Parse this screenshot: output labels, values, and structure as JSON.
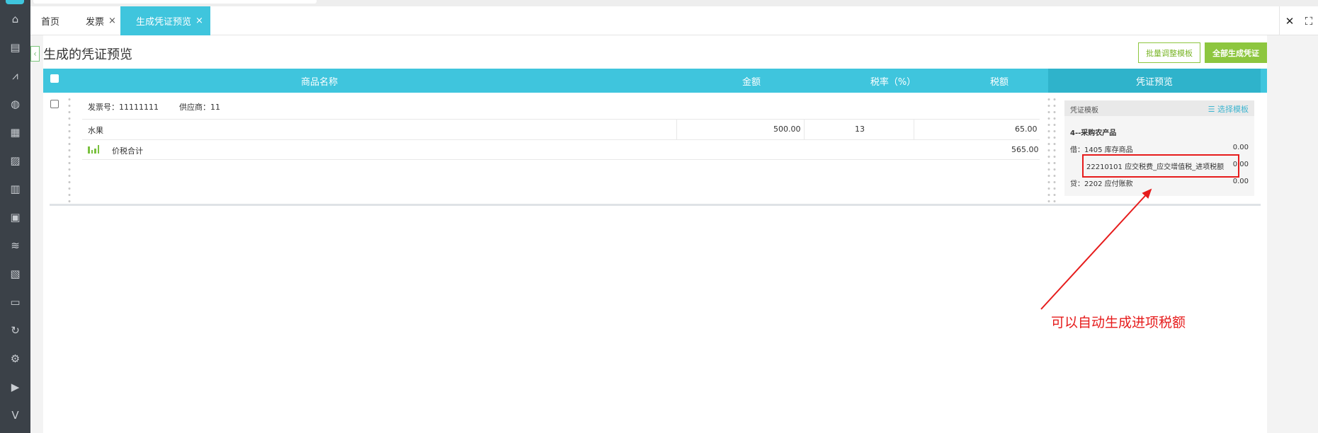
{
  "tabs": [
    {
      "label": "首页"
    },
    {
      "label": "发票",
      "close": "×"
    },
    {
      "label": "生成凭证预览",
      "close": "×"
    }
  ],
  "window_controls": {
    "close": "✕",
    "fullscreen": "⛶"
  },
  "sidebar": {
    "icons": [
      "home-icon",
      "invoice-icon",
      "chart-icon",
      "money-bag-icon",
      "document-icon",
      "report-icon",
      "store-icon",
      "dashboard-icon",
      "stack-icon",
      "voucher-icon",
      "inbox-icon",
      "refresh-icon",
      "settings-icon",
      "play-icon",
      "v-logo-icon"
    ]
  },
  "page": {
    "back": "‹",
    "title": "生成的凭证预览",
    "buttons": {
      "batch_adjust": "批量调整模板",
      "generate_all": "全部生成凭证"
    }
  },
  "table": {
    "columns": {
      "name": "商品名称",
      "amount": "金额",
      "tax_rate": "税率（%）",
      "tax": "税额",
      "voucher": "凭证预览"
    },
    "invoice_no": "发票号：11111111",
    "supplier": "供应商：11",
    "items": [
      {
        "name": "水果",
        "amount": "500.00",
        "tax_rate": "13",
        "tax": "65.00"
      }
    ],
    "total_label": "价税合计",
    "total": "565.00"
  },
  "voucher": {
    "header_label": "凭证模板",
    "select_template": "☰ 选择模板",
    "template_name": "4--采购农产品",
    "entries": [
      {
        "text": "借：1405 库存商品",
        "amount": "0.00"
      },
      {
        "text": "22210101 应交税费_应交增值税_进项税额",
        "amount": "0.00"
      },
      {
        "text": "贷：2202 应付账款",
        "amount": "0.00"
      }
    ]
  },
  "annotation": {
    "text": "可以自动生成进项税额",
    "color": "#e61c1c"
  },
  "colors": {
    "header": "#3fc5dd",
    "accent_green": "#8dc63f",
    "sidebar": "#3b4148"
  }
}
